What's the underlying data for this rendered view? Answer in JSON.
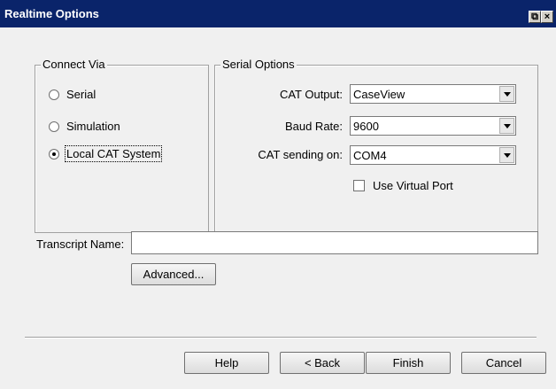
{
  "window": {
    "title": "Realtime Options",
    "restore_glyph": "⧉",
    "close_glyph": "×"
  },
  "connect_via": {
    "label": "Connect Via",
    "options": [
      {
        "label": "Serial",
        "checked": false
      },
      {
        "label": "Simulation",
        "checked": false
      },
      {
        "label": "Local CAT System",
        "checked": true
      }
    ]
  },
  "serial_options": {
    "label": "Serial Options",
    "cat_output": {
      "label": "CAT Output:",
      "value": "CaseView"
    },
    "baud_rate": {
      "label": "Baud Rate:",
      "value": "9600"
    },
    "cat_sending_on": {
      "label": "CAT sending on:",
      "value": "COM4"
    },
    "use_virtual_port": {
      "label": "Use Virtual Port",
      "checked": false
    }
  },
  "transcript": {
    "label": "Transcript Name:",
    "value": ""
  },
  "buttons": {
    "advanced": "Advanced...",
    "help": "Help",
    "back": "< Back",
    "finish": "Finish",
    "cancel": "Cancel"
  }
}
